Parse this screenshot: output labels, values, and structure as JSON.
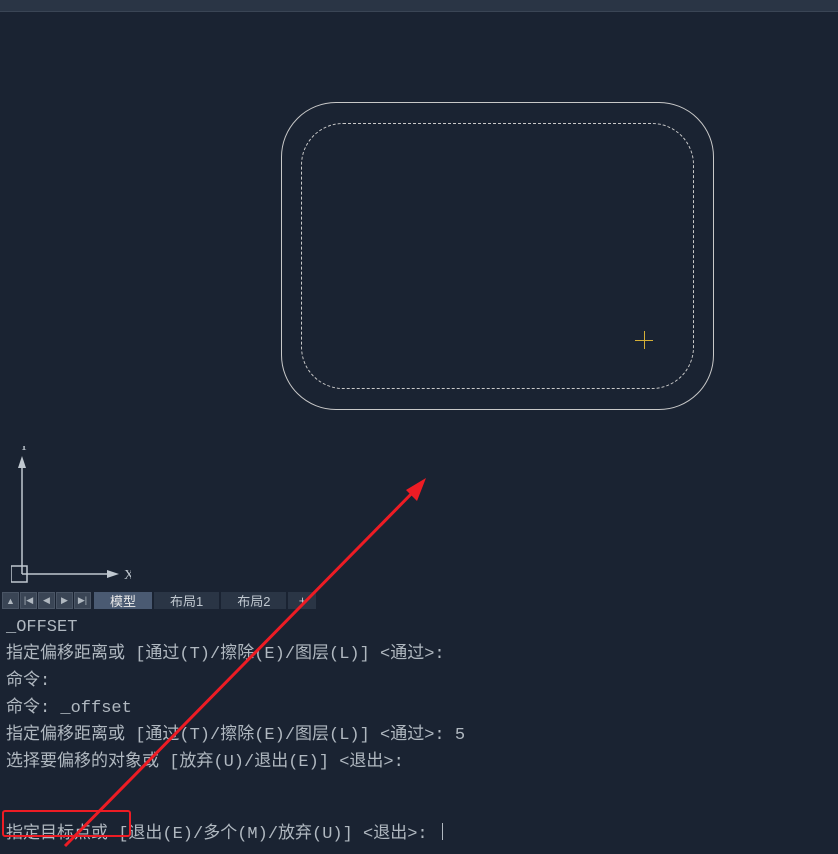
{
  "tabs": {
    "model": "模型",
    "layout1": "布局1",
    "layout2": "布局2",
    "plus": "+"
  },
  "ucs": {
    "x_label": "X",
    "y_label": "Y"
  },
  "nav": {
    "up": "▲",
    "first": "|◀",
    "prev": "◀",
    "next": "▶",
    "last": "▶|"
  },
  "command_history": {
    "line1": "_OFFSET",
    "line2": "指定偏移距离或 [通过(T)/擦除(E)/图层(L)] <通过>:",
    "line3": "命令:",
    "line4": "命令: _offset",
    "line5": "指定偏移距离或 [通过(T)/擦除(E)/图层(L)] <通过>: 5",
    "line6": "选择要偏移的对象或 [放弃(U)/退出(E)] <退出>:"
  },
  "command_prompt": {
    "text": "指定目标点或 [退出(E)/多个(M)/放弃(U)] <退出>: "
  }
}
